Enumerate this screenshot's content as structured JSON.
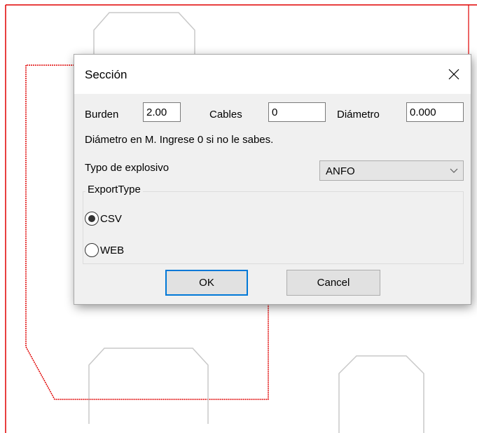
{
  "dialog": {
    "title": "Sección",
    "fields": {
      "burden_label": "Burden",
      "burden_value": "2.00",
      "cables_label": "Cables",
      "cables_value": "0",
      "diametro_label": "Diámetro",
      "diametro_value": "0.000"
    },
    "hint": "Diámetro en M. Ingrese 0 si no le sabes.",
    "explosive": {
      "label": "Typo de explosivo",
      "selected": "ANFO"
    },
    "export_group": {
      "legend": "ExportType",
      "options": [
        {
          "label": "CSV",
          "checked": true
        },
        {
          "label": "WEB",
          "checked": false
        }
      ]
    },
    "buttons": {
      "ok": "OK",
      "cancel": "Cancel"
    }
  },
  "colors": {
    "outline_red": "#e00000",
    "shape_gray": "#c8c8c8",
    "focus_blue": "#0078d7"
  },
  "icons": {
    "close": "close-icon",
    "dropdown": "chevron-down-icon"
  }
}
